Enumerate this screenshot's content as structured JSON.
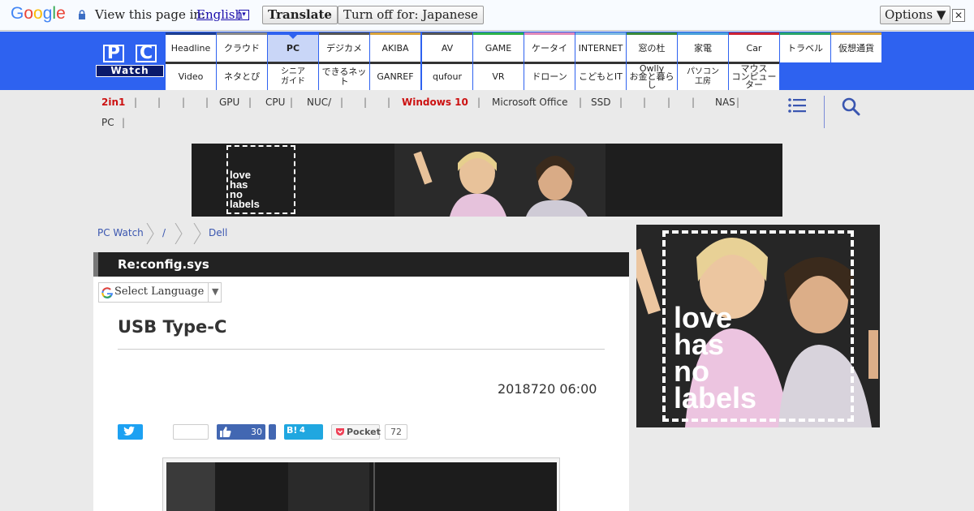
{
  "translate_bar": {
    "logo_text": "Google",
    "view_text": "View this page in:",
    "language": "English",
    "translate_button": "Translate",
    "turn_off_button": "Turn off for: Japanese",
    "options_button": "Options ▼",
    "close_glyph": "✕"
  },
  "header": {
    "logo_letters": [
      "P",
      "C"
    ],
    "logo_sub": "Watch",
    "nav_row1": [
      "Headline",
      "クラウド",
      "PC",
      "デジカメ",
      "AKIBA",
      "AV",
      "GAME",
      "ケータイ",
      "INTERNET",
      "窓の杜",
      "家電",
      "Car",
      "トラベル",
      "仮想通貨"
    ],
    "nav_row2": [
      "Video",
      "ネタとぴ",
      "シニア\nガイド",
      "できるネット",
      "GANREF",
      "qufour",
      "VR",
      "ドローン",
      "こどもとIT",
      "Owlly\nお金と暮らし",
      "パソコン\n工房",
      "マウス\nコンピューター"
    ],
    "active_tab": "PC",
    "row1_colors": [
      "#1f3f8f",
      "#888888",
      "#2e62f0",
      "#555555",
      "#d8a23a",
      "#555555",
      "#2db24a",
      "#e08ab8",
      "#7bb7e0",
      "#3a8a3a",
      "#4aa0d8",
      "#cc2233",
      "#2aa56a",
      "#d8a23a"
    ],
    "row2_color": "#333333"
  },
  "subnav": {
    "row1": [
      "2in1",
      "GPU",
      "CPU",
      "NUC/",
      "Windows 10",
      "Microsoft Office",
      "SSD",
      "NAS"
    ],
    "row2": [
      "PC"
    ],
    "separator": "|",
    "highlight_color": "#cc1111"
  },
  "banner": {
    "text_lines": [
      "love",
      "has",
      "no",
      "labels"
    ]
  },
  "breadcrumb": {
    "items": [
      "PC Watch",
      "/",
      "Dell"
    ]
  },
  "side_ad": {
    "text_lines": [
      "love",
      "has",
      "no",
      "labels"
    ]
  },
  "article": {
    "series": "Re:config.sys",
    "select_language": "Select Language",
    "select_arrow": "▼",
    "title": "USB Type-C",
    "date": "2018720 06:00",
    "social": {
      "facebook_count": "30",
      "hatena_label": "B!",
      "hatena_count": "4",
      "pocket_label": "Pocket",
      "pocket_count": "72"
    }
  }
}
